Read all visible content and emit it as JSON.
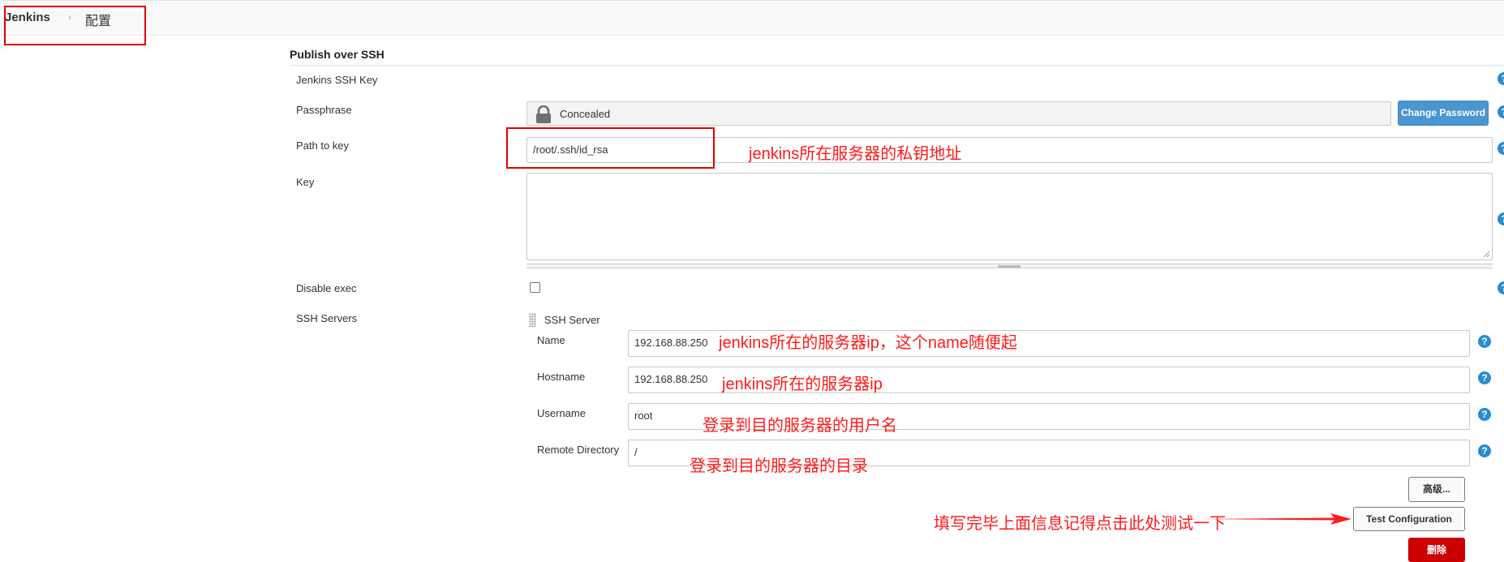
{
  "breadcrumb": {
    "home": "Jenkins",
    "separator": "›",
    "current": "配置"
  },
  "section": {
    "title": "Publish over SSH"
  },
  "fields": {
    "ssh_key_label": "Jenkins SSH Key",
    "passphrase_label": "Passphrase",
    "passphrase_value": "Concealed",
    "change_password": "Change Password",
    "path_label": "Path to key",
    "path_value": "/root/.ssh/id_rsa",
    "key_label": "Key",
    "disable_exec_label": "Disable exec",
    "disable_exec_checked": false,
    "ssh_servers_label": "SSH Servers"
  },
  "server": {
    "title": "SSH Server",
    "name_label": "Name",
    "name_value": "192.168.88.250",
    "hostname_label": "Hostname",
    "hostname_value": "192.168.88.250",
    "username_label": "Username",
    "username_value": "root",
    "remote_dir_label": "Remote Directory",
    "remote_dir_value": "/",
    "advanced_button": "高级...",
    "test_button": "Test Configuration",
    "delete_button": "删除"
  },
  "help_symbol": "?",
  "annotations": {
    "path": "jenkins所在服务器的私钥地址",
    "name": "jenkins所在的服务器ip，这个name随便起",
    "hostname": "jenkins所在的服务器ip",
    "username": "登录到目的服务器的用户名",
    "remote_dir": "登录到目的服务器的目录",
    "test": "填写完毕上面信息记得点击此处测试一下"
  },
  "colors": {
    "annotation": "#ff1a1a",
    "help": "#2a8bd1",
    "primary_button": "#4b95d0",
    "danger_button": "#cc0000"
  }
}
